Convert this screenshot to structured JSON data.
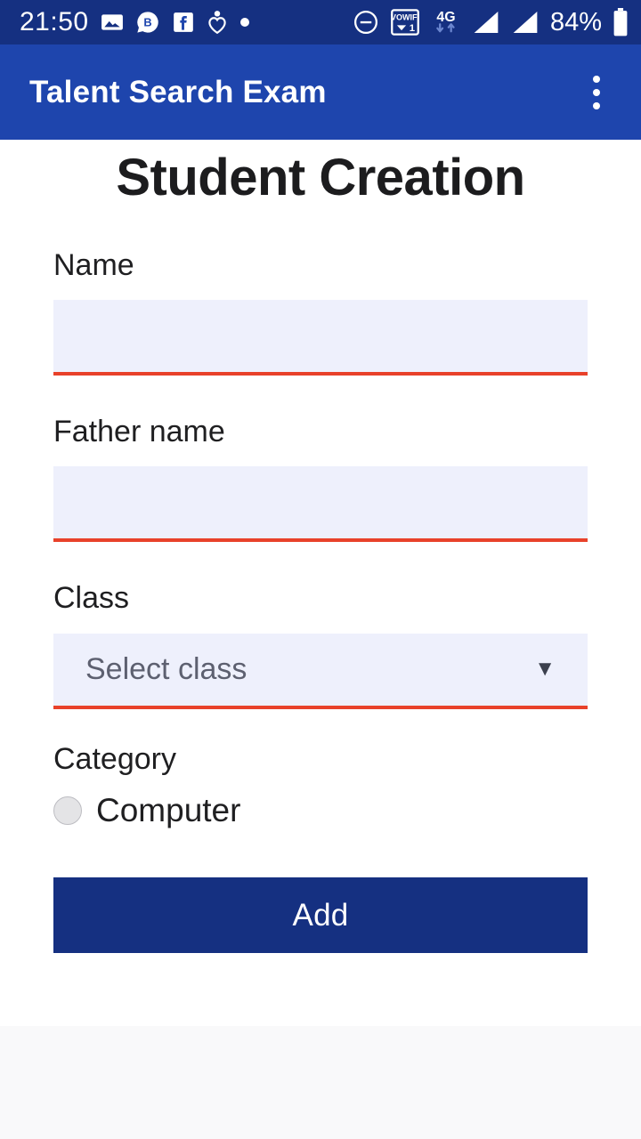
{
  "status_bar": {
    "clock": "21:50",
    "battery_percent": "84%",
    "network_type": "4G",
    "vowifi_label": "VOWIFI",
    "vowifi_slot": "1",
    "background_color": "#153081",
    "left_icons": [
      "photo-icon",
      "botim-b-chat-icon",
      "facebook-icon",
      "health-heart-icon",
      "dot-icon"
    ],
    "right_icons": [
      "do-not-disturb-icon",
      "vowifi-icon",
      "mobile-data-4g-icon",
      "signal-bars-sim1-icon",
      "signal-bars-sim2-icon",
      "battery-icon"
    ]
  },
  "app_bar": {
    "title": "Talent Search Exam",
    "overflow_menu": "more-options",
    "background_color": "#1e45ad"
  },
  "page": {
    "title": "Student Creation",
    "accent_underline_color": "#e8412a",
    "input_fill_color": "#eef0fc",
    "primary_button_color": "#153081"
  },
  "form": {
    "name": {
      "label": "Name",
      "value": "",
      "placeholder": ""
    },
    "father_name": {
      "label": "Father name",
      "value": "",
      "placeholder": ""
    },
    "class": {
      "label": "Class",
      "selected": "Select class",
      "caret": "▼"
    },
    "category": {
      "label": "Category",
      "options": [
        {
          "label": "Computer",
          "selected": false
        }
      ]
    },
    "submit_label": "Add"
  }
}
